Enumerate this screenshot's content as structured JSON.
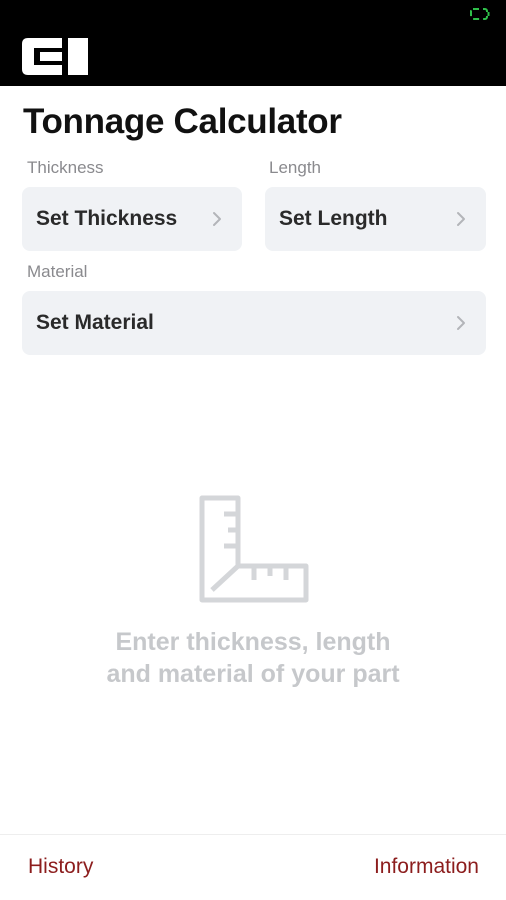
{
  "header": {
    "logo_text": "CI",
    "battery_icon": "battery-charging-icon"
  },
  "page": {
    "title": "Tonnage Calculator"
  },
  "fields": {
    "thickness": {
      "label": "Thickness",
      "value": "Set Thickness"
    },
    "length": {
      "label": "Length",
      "value": "Set Length"
    },
    "material": {
      "label": "Material",
      "value": "Set Material"
    }
  },
  "empty_state": {
    "icon": "ruler-square-icon",
    "line1": "Enter thickness, length",
    "line2": "and material of your part"
  },
  "footer": {
    "history_label": "History",
    "information_label": "Information"
  },
  "colors": {
    "header_bg": "#000000",
    "tile_bg": "#f0f2f5",
    "footer_link": "#8c1d1d",
    "battery": "#2fbf4a"
  }
}
